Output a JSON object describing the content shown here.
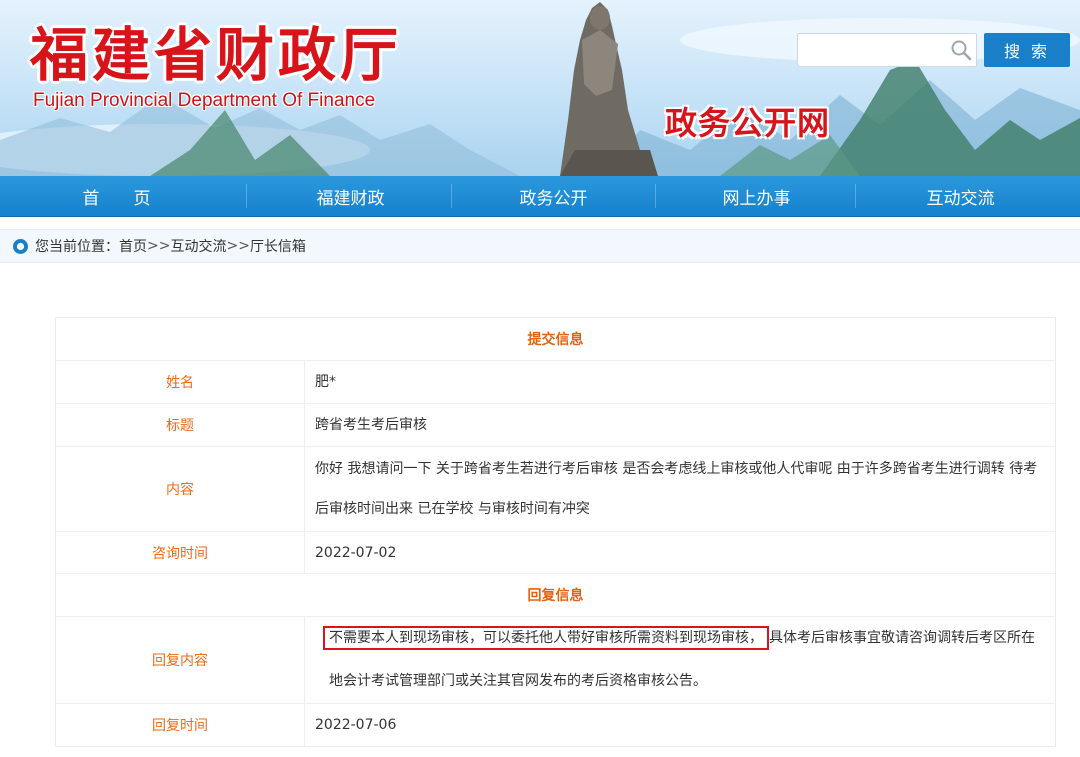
{
  "header": {
    "title": "福建省财政厅",
    "subtitle": "Fujian Provincial Department Of Finance",
    "portal_name": "政务公开网",
    "search": {
      "placeholder": "",
      "button_label": "搜 索"
    }
  },
  "nav": {
    "items": [
      {
        "label": "首　　页"
      },
      {
        "label": "福建财政"
      },
      {
        "label": "政务公开"
      },
      {
        "label": "网上办事"
      },
      {
        "label": "互动交流"
      }
    ]
  },
  "breadcrumb": {
    "prefix": "您当前位置：",
    "items": [
      "首页",
      "互动交流",
      "厅长信箱"
    ],
    "separator": ">>"
  },
  "letter": {
    "submit_header": "提交信息",
    "reply_header": "回复信息",
    "name": {
      "label": "姓名",
      "value": "肥*"
    },
    "title": {
      "label": "标题",
      "value": "跨省考生考后审核"
    },
    "content": {
      "label": "内容",
      "value": "你好 我想请问一下 关于跨省考生若进行考后审核 是否会考虑线上审核或他人代审呢 由于许多跨省考生进行调转 待考后审核时间出来 已在学校 与审核时间有冲突"
    },
    "ask_time": {
      "label": "咨询时间",
      "value": "2022-07-02"
    },
    "reply_content": {
      "label": "回复内容",
      "highlighted": "不需要本人到现场审核，可以委托他人带好审核所需资料到现场审核，",
      "rest": "具体考后审核事宜敬请咨询调转后考区所在地会计考试管理部门或关注其官网发布的考后资格审核公告。"
    },
    "reply_time": {
      "label": "回复时间",
      "value": "2022-07-06"
    }
  },
  "colors": {
    "brand_red": "#d8141b",
    "nav_blue": "#1a7fc9",
    "label_orange": "#ef6a17",
    "highlight_box": "#d9151b"
  }
}
